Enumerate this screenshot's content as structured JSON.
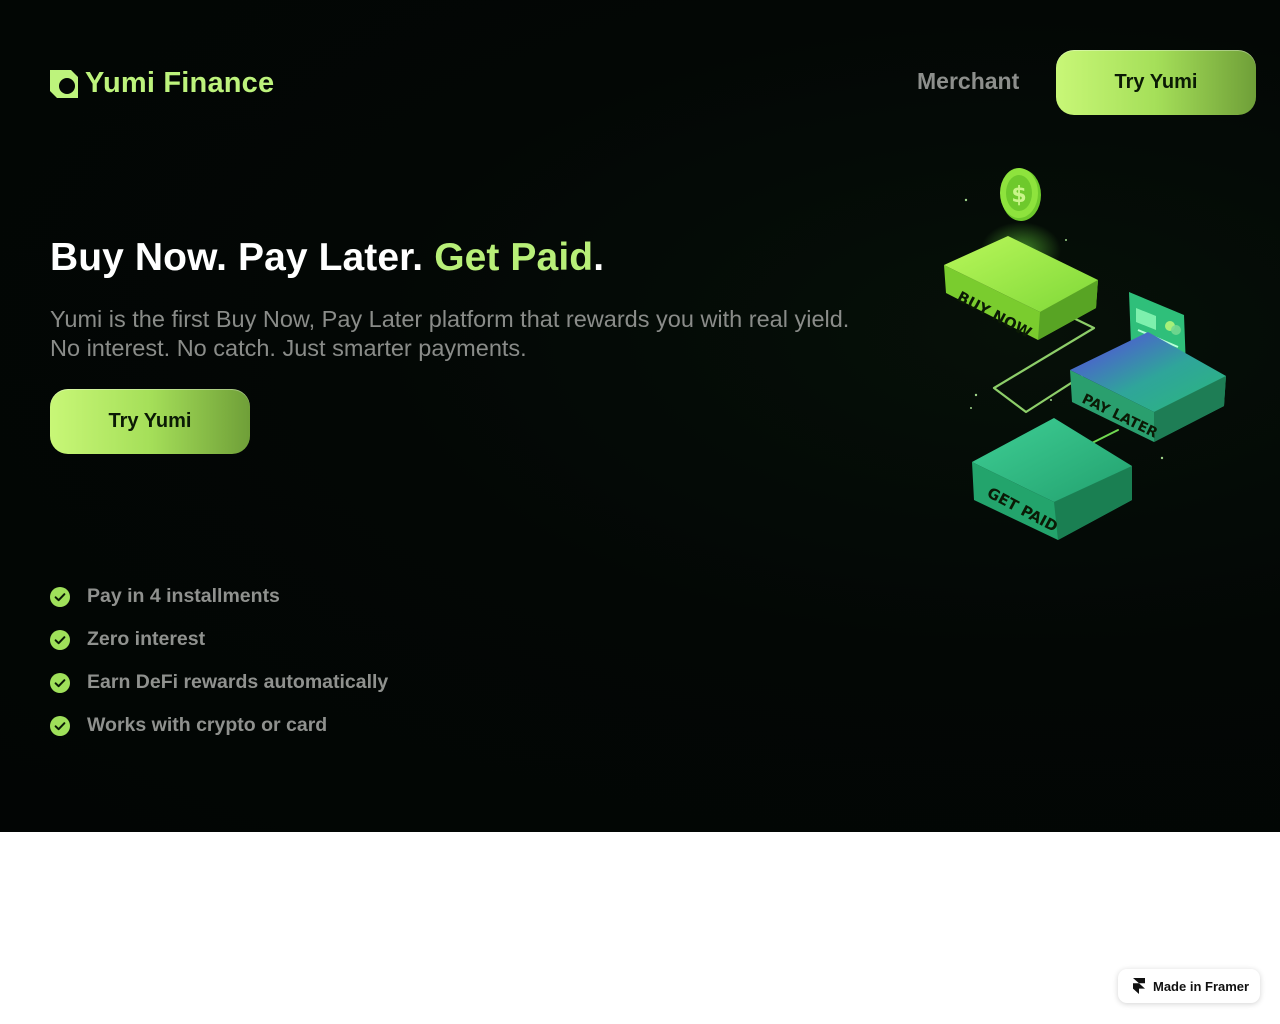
{
  "header": {
    "logo_text": "Yumi Finance",
    "nav_merchant": "Merchant",
    "cta_label": "Try Yumi"
  },
  "hero": {
    "headline_main": "Buy Now. Pay Later.",
    "headline_accent": "Get Paid",
    "headline_end": ".",
    "subtext": "Yumi is the first Buy Now, Pay Later platform that rewards you with real yield. No interest. No catch. Just smarter payments.",
    "cta_label": "Try Yumi"
  },
  "features": [
    {
      "label": "Pay in 4 installments",
      "icon": "check-circle-icon"
    },
    {
      "label": "Zero interest",
      "icon": "check-circle-icon"
    },
    {
      "label": "Earn DeFi rewards automatically",
      "icon": "check-circle-icon"
    },
    {
      "label": "Works with crypto or card",
      "icon": "check-circle-icon"
    }
  ],
  "illustration": {
    "coin_symbol": "$",
    "block_buy": "BUY NOW",
    "block_pay": "PAY LATER",
    "block_get": "GET PAID"
  },
  "badge": {
    "label": "Made in Framer",
    "icon": "framer-icon"
  },
  "colors": {
    "accent": "#b8ef78",
    "hero_bg": "#030705",
    "muted_text": "#8a8c89"
  }
}
